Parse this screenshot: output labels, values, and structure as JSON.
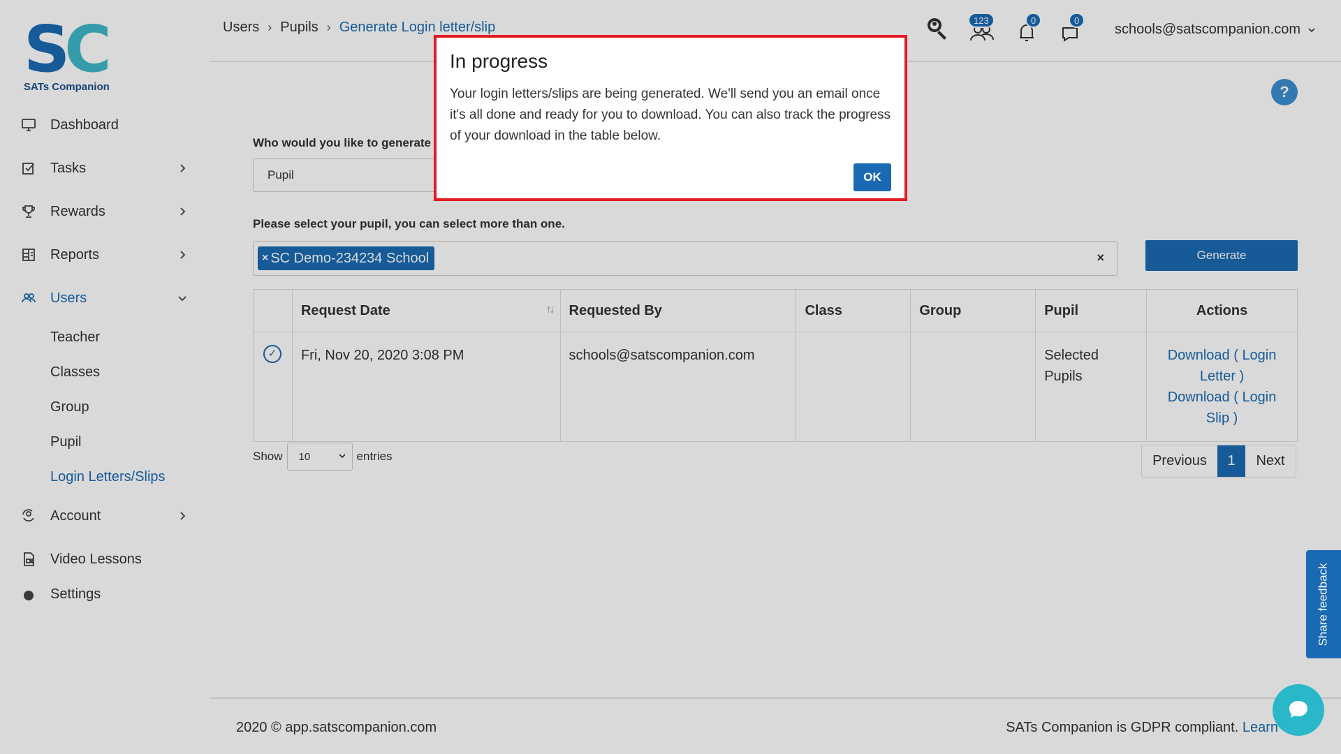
{
  "sidebar": {
    "brand": "SATs Companion",
    "logo_letters": [
      "S",
      "C"
    ],
    "items": [
      {
        "label": "Dashboard",
        "icon": "monitor-icon"
      },
      {
        "label": "Tasks",
        "icon": "tasks-icon"
      },
      {
        "label": "Rewards",
        "icon": "trophy-icon"
      },
      {
        "label": "Reports",
        "icon": "reports-icon"
      },
      {
        "label": "Users",
        "icon": "users-icon"
      },
      {
        "label": "Account",
        "icon": "account-icon"
      },
      {
        "label": "Video Lessons",
        "icon": "video-icon"
      },
      {
        "label": "Settings",
        "icon": "gear-icon"
      }
    ],
    "users_sub": [
      "Teacher",
      "Classes",
      "Group",
      "Pupil",
      "Login Letters/Slips"
    ]
  },
  "header": {
    "breadcrumb": [
      "Users",
      "Pupils",
      "Generate Login letter/slip"
    ],
    "badges": {
      "users": "123",
      "notifications": "0",
      "messages": "0"
    },
    "user_email": "schools@satscompanion.com"
  },
  "form": {
    "who_label": "Who would you like to generate",
    "who_value": "Pupil",
    "select_label": "Please select your pupil, you can select more than one.",
    "selected_tag": "SC Demo-234234 School",
    "generate_label": "Generate"
  },
  "table": {
    "headers": [
      "",
      "Request Date",
      "Requested By",
      "Class",
      "Group",
      "Pupil",
      "Actions"
    ],
    "rows": [
      {
        "request_date": "Fri, Nov 20, 2020 3:08 PM",
        "requested_by": "schools@satscompanion.com",
        "class": "",
        "group": "",
        "pupil": "Selected Pupils",
        "action_letter": "Download ( Login Letter )",
        "action_slip": "Download ( Login Slip )"
      }
    ]
  },
  "pagination": {
    "show_label": "Show",
    "length": "10",
    "entries_label": "entries",
    "previous": "Previous",
    "page": "1",
    "next": "Next"
  },
  "footer": {
    "copyright": "2020 © app.satscompanion.com",
    "gdpr": "SATs Companion is GDPR compliant.",
    "learn": "Learn"
  },
  "feedback_label": "Share feedback",
  "modal": {
    "title": "In progress",
    "body": "Your login letters/slips are being generated. We'll send you an email once it's all done and ready for you to download. You can also track the progress of your download in the table below.",
    "ok_label": "OK"
  },
  "colors": {
    "accent": "#1a6ab3",
    "modal_border": "#e31b23",
    "chat": "#2ab7ca"
  }
}
